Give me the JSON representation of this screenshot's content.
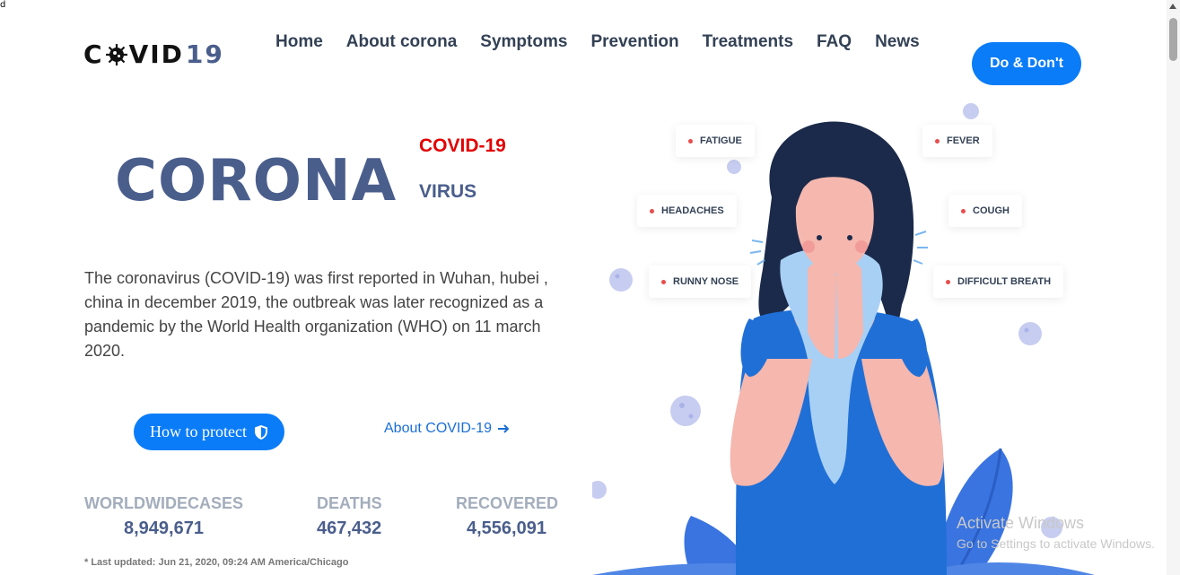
{
  "corner_mark": "d",
  "logo": {
    "prefix_c": "C",
    "suffix": "VID",
    "number": "19"
  },
  "nav": [
    "Home",
    "About corona",
    "Symptoms",
    "Prevention",
    "Treatments",
    "FAQ",
    "News"
  ],
  "header_button": "Do & Don't",
  "hero": {
    "title": "CORONA",
    "tag_red": "COVID-19",
    "tag_virus": "VIRUS",
    "description": "The coronavirus (COVID-19) was first reported in Wuhan, hubei , china in december 2019, the outbreak was later recognized as a pandemic by the World Health organization (WHO) on 11 march 2020."
  },
  "actions": {
    "protect": "How to protect",
    "about": "About COVID-19"
  },
  "stats": [
    {
      "label": "WORLDWIDECASES",
      "value": "8,949,671"
    },
    {
      "label": "DEATHS",
      "value": "467,432"
    },
    {
      "label": "RECOVERED",
      "value": "4,556,091"
    }
  ],
  "updated": "* Last updated: Jun 21, 2020, 09:24 AM America/Chicago",
  "symptoms": [
    "FATIGUE",
    "FEVER",
    "HEADACHES",
    "COUGH",
    "RUNNY NOSE",
    "DIFFICULT BREATH"
  ],
  "windows_notice": {
    "title": "Activate Windows",
    "subtitle": "Go to Settings to activate Windows."
  },
  "colors": {
    "accent": "#0a7cf8",
    "title": "#4a5e8c",
    "red": "#e30000"
  }
}
